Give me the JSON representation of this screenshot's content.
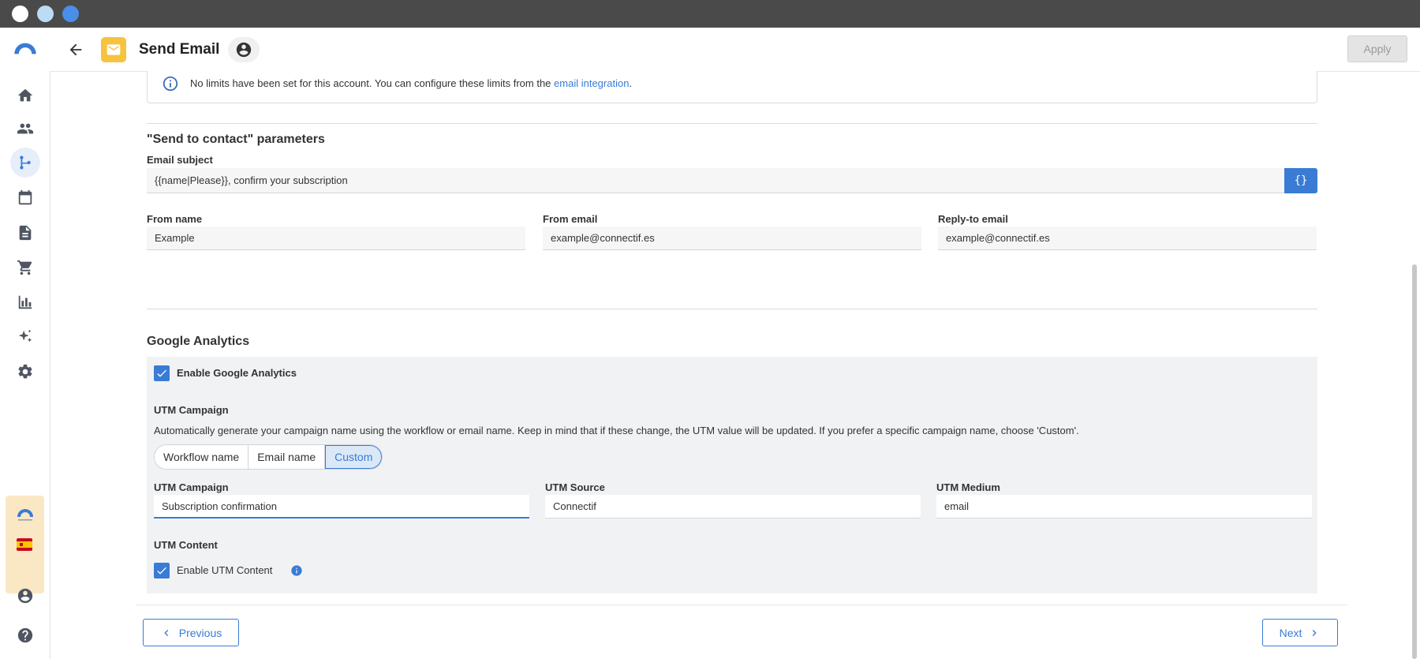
{
  "window": {
    "title": "Send Email"
  },
  "header": {
    "title": "Send Email",
    "apply_label": "Apply"
  },
  "sidebar": {
    "items": [
      {
        "name": "home-icon"
      },
      {
        "name": "contacts-icon"
      },
      {
        "name": "workflows-icon",
        "active": true
      },
      {
        "name": "calendar-icon"
      },
      {
        "name": "content-icon"
      },
      {
        "name": "cart-icon"
      },
      {
        "name": "analytics-icon"
      },
      {
        "name": "sparkle-icon"
      },
      {
        "name": "settings-icon"
      }
    ],
    "flag_label": "ES"
  },
  "notice": {
    "text": "No limits have been set for this account. You can configure these limits from the",
    "link": "email integration",
    "suffix": "."
  },
  "send_params": {
    "title": "\"Send to contact\" parameters",
    "subject_label": "Email subject",
    "subject_value": "{{name|Please}}, confirm your subscription",
    "variables_button": "{}",
    "from_name_label": "From name",
    "from_name_value": "Example",
    "from_email_label": "From email",
    "from_email_value": "example@connectif.es",
    "reply_to_label": "Reply-to email",
    "reply_to_value": "example@connectif.es"
  },
  "google_analytics": {
    "title": "Google Analytics",
    "enable_label": "Enable Google Analytics",
    "enable_checked": true,
    "utm_campaign_heading": "UTM Campaign",
    "utm_description": "Automatically generate your campaign name using the workflow or email name. Keep in mind that if these change, the UTM value will be updated. If you prefer a specific campaign name, choose 'Custom'.",
    "campaign_modes": [
      "Workflow name",
      "Email name",
      "Custom"
    ],
    "campaign_mode_selected": "Custom",
    "utm_campaign_label": "UTM Campaign",
    "utm_campaign_value": "Subscription confirmation",
    "utm_source_label": "UTM Source",
    "utm_source_value": "Connectif",
    "utm_medium_label": "UTM Medium",
    "utm_medium_value": "email",
    "utm_content_heading": "UTM Content",
    "utm_content_enable_label": "Enable UTM Content",
    "utm_content_checked": true
  },
  "footer": {
    "previous_label": "Previous",
    "next_label": "Next"
  },
  "colors": {
    "accent": "#3a7bd5",
    "email_tile": "#f7c33e",
    "panel_bg": "#f1f2f4",
    "titlebar": "#4a4a4a"
  }
}
